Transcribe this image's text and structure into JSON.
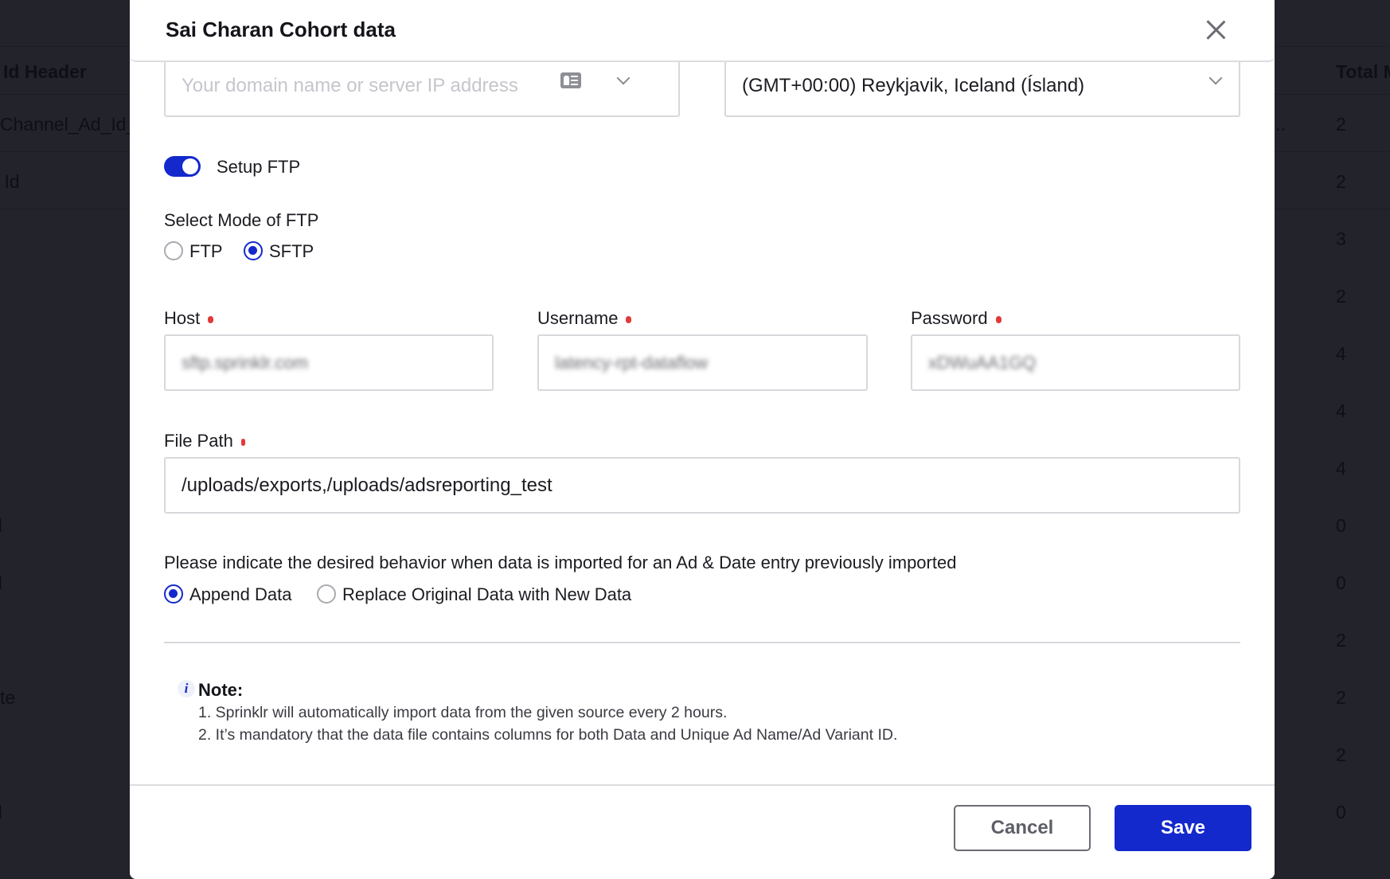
{
  "background": {
    "table_header_left": "Id Header",
    "table_header_right": "Total M",
    "left_cells": [
      "Channel_Ad_Id_",
      "l Id",
      "d",
      "d",
      "te",
      "d"
    ],
    "right_truncation": "..",
    "right_values": [
      "2",
      "2",
      "3",
      "2",
      "4",
      "4",
      "4",
      "0",
      "0",
      "2",
      "2",
      "2",
      "0"
    ]
  },
  "modal": {
    "title": "Sai Charan Cohort data",
    "close_label": "Close",
    "domain_field": {
      "placeholder": "Your domain name or server IP address"
    },
    "timezone_select": {
      "value": "(GMT+00:00) Reykjavik, Iceland (Ísland)"
    },
    "setup_ftp": {
      "label": "Setup FTP",
      "enabled": true
    },
    "ftp_mode": {
      "label": "Select Mode of FTP",
      "options": [
        {
          "label": "FTP",
          "selected": false
        },
        {
          "label": "SFTP",
          "selected": true
        }
      ]
    },
    "host": {
      "label": "Host",
      "value": "sftp.sprinklr.com",
      "required": true
    },
    "username": {
      "label": "Username",
      "value": "latency-rpt-dataflow",
      "required": true
    },
    "password": {
      "label": "Password",
      "value": "xDWuAA1GQ",
      "required": true
    },
    "file_path": {
      "label": "File Path",
      "value": "/uploads/exports,/uploads/adsreporting_test",
      "required": true
    },
    "behavior": {
      "label": "Please indicate the desired behavior when data is imported for an Ad & Date entry previously imported",
      "options": [
        {
          "label": "Append Data",
          "selected": true
        },
        {
          "label": "Replace Original Data with New Data",
          "selected": false
        }
      ]
    },
    "note": {
      "title": "Note:",
      "lines": [
        "1. Sprinklr will automatically import data from the given source every 2 hours.",
        "2. It’s mandatory that the data file contains columns for both Data and Unique Ad Name/Ad Variant ID."
      ]
    },
    "footer": {
      "cancel_label": "Cancel",
      "save_label": "Save"
    }
  },
  "colors": {
    "accent": "#1329cc",
    "required": "#e03a3a",
    "overlay": "#22232b"
  }
}
